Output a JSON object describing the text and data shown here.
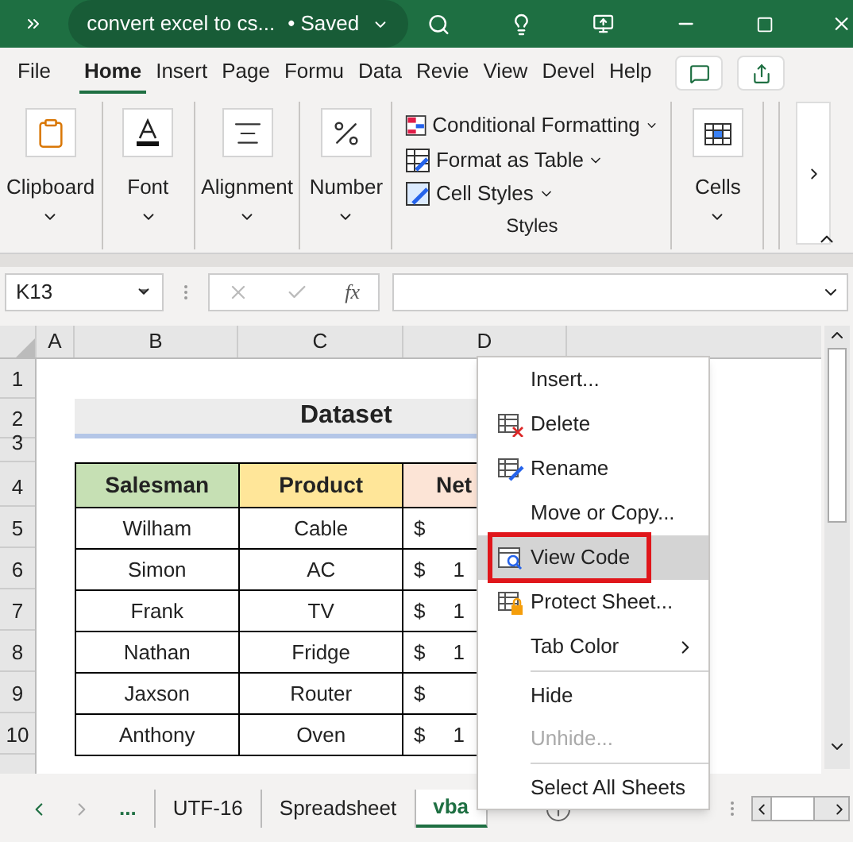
{
  "title_bar": {
    "title": "convert excel to cs...",
    "status": "• Saved"
  },
  "ribbon_tabs": [
    {
      "label": "File",
      "selected": false
    },
    {
      "label": "Home",
      "selected": true
    },
    {
      "label": "Insert",
      "selected": false
    },
    {
      "label": "Page",
      "selected": false
    },
    {
      "label": "Formu",
      "selected": false
    },
    {
      "label": "Data",
      "selected": false
    },
    {
      "label": "Revie",
      "selected": false
    },
    {
      "label": "View",
      "selected": false
    },
    {
      "label": "Devel",
      "selected": false
    },
    {
      "label": "Help",
      "selected": false
    }
  ],
  "ribbon_groups": [
    {
      "kind": "big",
      "label": "Clipboard"
    },
    {
      "kind": "big",
      "label": "Font"
    },
    {
      "kind": "big",
      "label": "Alignment"
    },
    {
      "kind": "big",
      "label": "Number"
    },
    {
      "kind": "list",
      "label": "Styles",
      "items": [
        "Conditional Formatting",
        "Format as Table",
        "Cell Styles"
      ]
    },
    {
      "kind": "big",
      "label": "Cells"
    }
  ],
  "formula_bar": {
    "name_box": "K13",
    "fx": "fx"
  },
  "columns": [
    "A",
    "B",
    "C",
    "D"
  ],
  "row_numbers": [
    "1",
    "2",
    "3",
    "4",
    "5",
    "6",
    "7",
    "8",
    "9",
    "10"
  ],
  "title_cell": "Dataset",
  "table": {
    "headers": [
      {
        "label": "Salesman",
        "color": "#c6e0b4"
      },
      {
        "label": "Product",
        "color": "#ffe699"
      },
      {
        "label": "Net",
        "color": "#fce4d6"
      }
    ],
    "rows": [
      [
        "Wilham",
        "Cable",
        "$"
      ],
      [
        "Simon",
        "AC",
        "$ 1"
      ],
      [
        "Frank",
        "TV",
        "$ 1"
      ],
      [
        "Nathan",
        "Fridge",
        "$ 1"
      ],
      [
        "Jaxson",
        "Router",
        "$"
      ],
      [
        "Anthony",
        "Oven",
        "$ 1"
      ]
    ]
  },
  "sheet_tabs": [
    {
      "label": "...",
      "selected": false,
      "kind": "more"
    },
    {
      "label": "UTF-16",
      "selected": false,
      "kind": "sheet"
    },
    {
      "label": "Spreadsheet",
      "selected": false,
      "kind": "sheet"
    },
    {
      "label": "vba",
      "selected": true,
      "kind": "sheet"
    }
  ],
  "context_menu": [
    {
      "label": "Insert...",
      "selected": false,
      "disabled": false,
      "submenu": false,
      "separator_before": false
    },
    {
      "label": "Delete",
      "selected": false,
      "disabled": false,
      "submenu": false,
      "separator_before": false
    },
    {
      "label": "Rename",
      "selected": false,
      "disabled": false,
      "submenu": false,
      "separator_before": false
    },
    {
      "label": "Move or Copy...",
      "selected": false,
      "disabled": false,
      "submenu": false,
      "separator_before": false
    },
    {
      "label": "View Code",
      "selected": true,
      "disabled": false,
      "submenu": false,
      "separator_before": false
    },
    {
      "label": "Protect Sheet...",
      "selected": false,
      "disabled": false,
      "submenu": false,
      "separator_before": false
    },
    {
      "label": "Tab Color",
      "selected": false,
      "disabled": false,
      "submenu": true,
      "separator_before": false
    },
    {
      "label": "Hide",
      "selected": false,
      "disabled": false,
      "submenu": false,
      "separator_before": true
    },
    {
      "label": "Unhide...",
      "selected": false,
      "disabled": true,
      "submenu": false,
      "separator_before": false
    },
    {
      "label": "Select All Sheets",
      "selected": false,
      "disabled": false,
      "submenu": false,
      "separator_before": true
    }
  ]
}
